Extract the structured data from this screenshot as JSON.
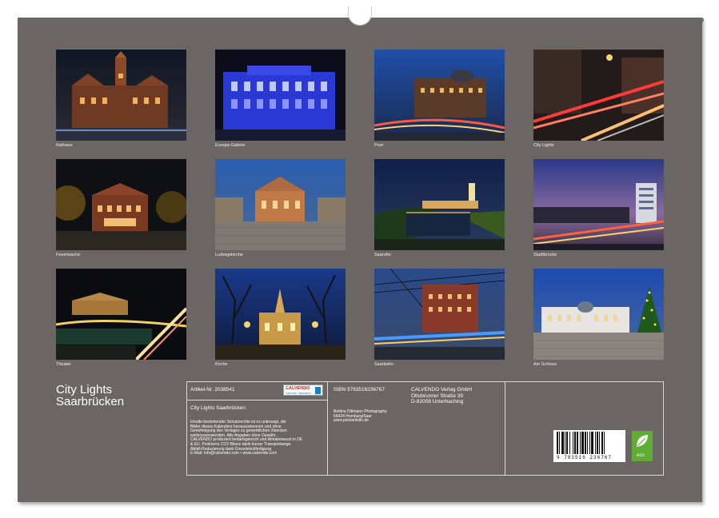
{
  "tiles": [
    {
      "caption": "Rathaus"
    },
    {
      "caption": "Europa-Galerie"
    },
    {
      "caption": "Post"
    },
    {
      "caption": "City Lights"
    },
    {
      "caption": "Feuerwache"
    },
    {
      "caption": "Ludwigskirche"
    },
    {
      "caption": "Saarufer"
    },
    {
      "caption": "Stadtbrücke"
    },
    {
      "caption": "Theater"
    },
    {
      "caption": "Kirche"
    },
    {
      "caption": "Saarbahn"
    },
    {
      "caption": "Am Schloss"
    }
  ],
  "title": {
    "line1": "City Lights",
    "line2": "Saarbrücken"
  },
  "info": {
    "article": "Artikel-Nr. 2038541",
    "isbn": "ISBN 9783516236767",
    "calendar_title": "City Lights Saarbrücken",
    "publisher": [
      "CALVENDO Verlag GmbH",
      "Ottobrunner Straße 39",
      "D-82008 Unterhaching"
    ],
    "author": [
      "Bettina Dittmann Photography",
      "66424 Homburg/Saar",
      "www.pixelartistin.de"
    ],
    "legal": [
      "Inhalte bestehender Schutzrechte ist es untersagt, die",
      "Bilder dieses Kalenders herauszutrennen und ohne",
      "Genehmigung des Verlages zu gewerblichen Zwecken",
      "weiterzuverwenden. Alle Angaben ohne Gewähr.",
      "CALVENDO produziert bedarfsgerecht und klimabewusst in DE",
      "& EU. Positivere CO2-Bilanz dank kurzer Transportwege.",
      "Abfall-Reduzierung dank Einzelstückfertigung.",
      "E-Mail: info@calvendo.com • www.calvendo.com"
    ],
    "barcode_number": "9 783516 236767",
    "calvendo_logo": "CALVENDO",
    "calvendo_logo_sub": "Kalender. Inspiration.",
    "eco_label": "eco"
  },
  "colors": {
    "sheet": "#6b6664",
    "eco": "#5fae33"
  }
}
